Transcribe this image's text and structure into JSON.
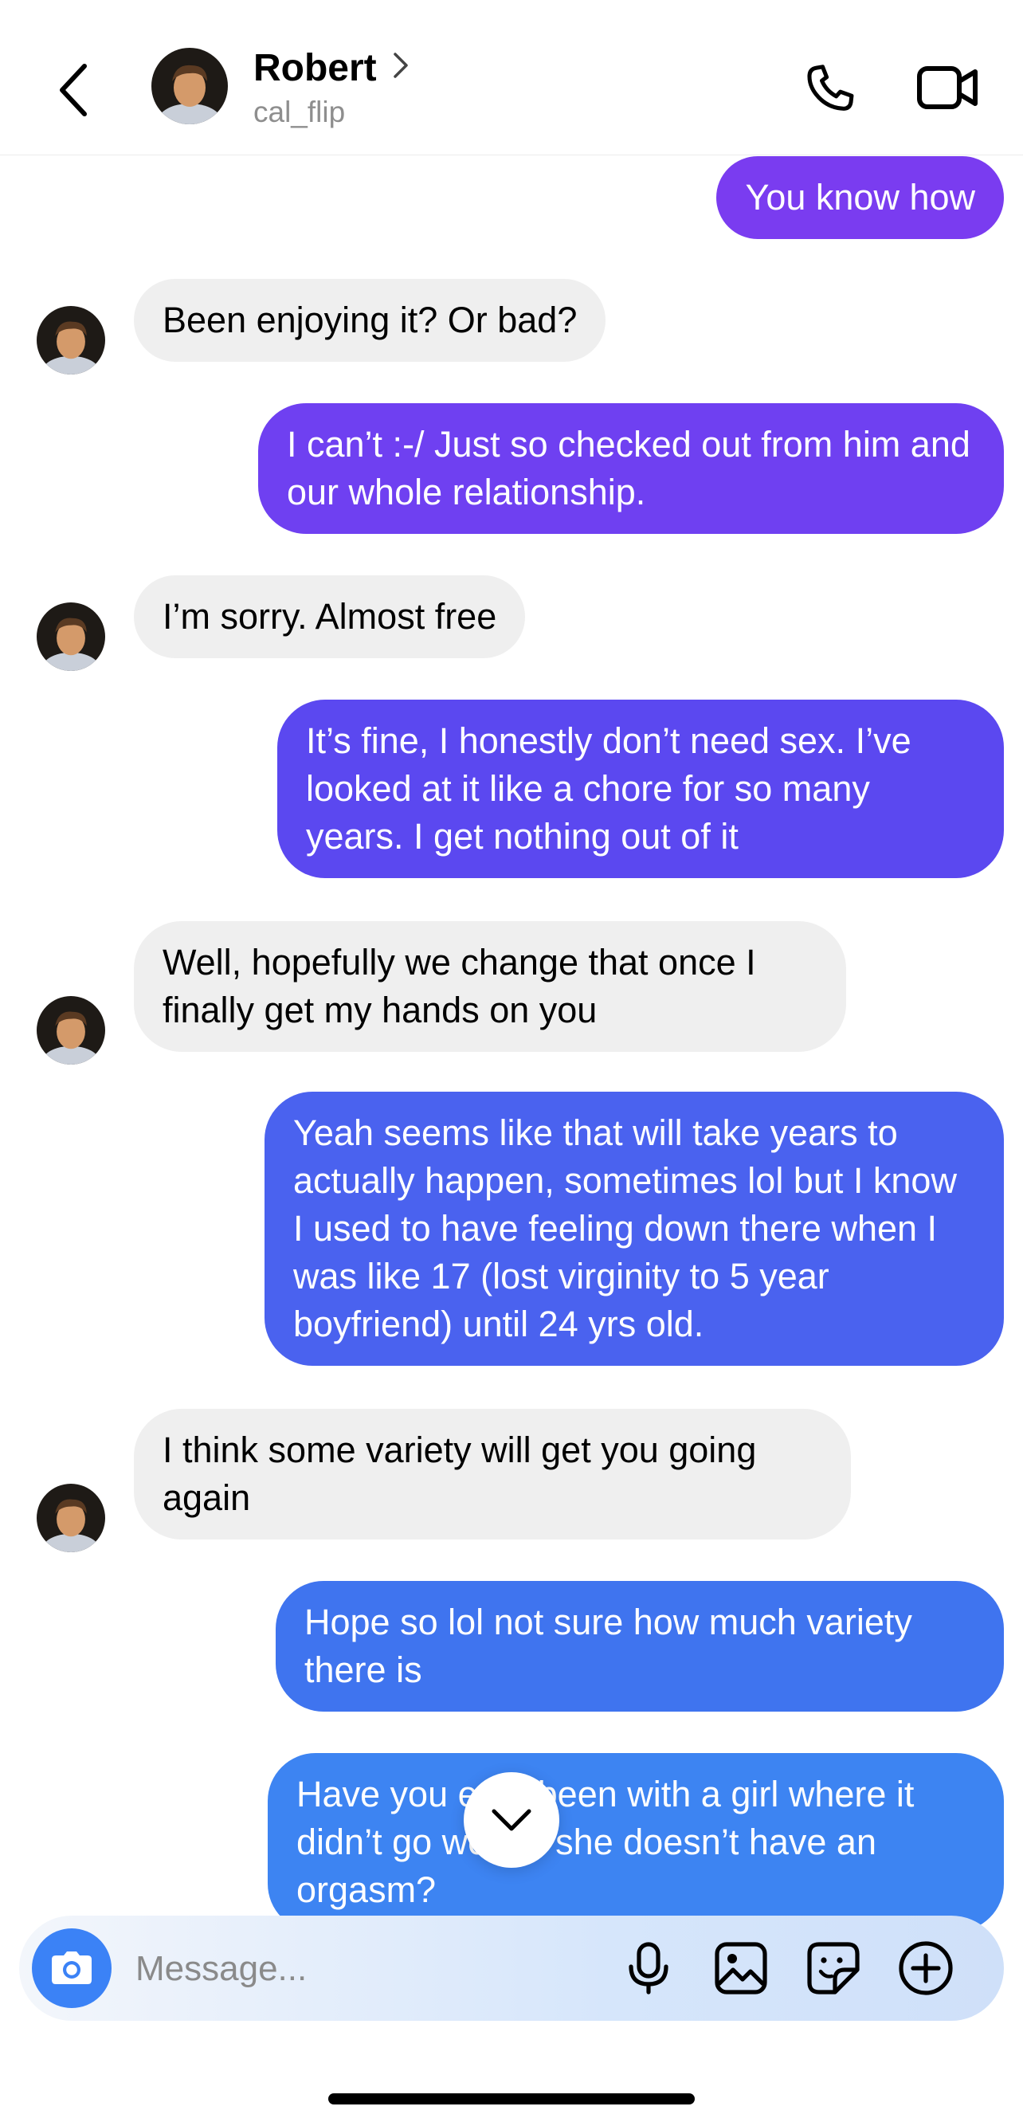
{
  "header": {
    "name": "Robert",
    "username": "cal_flip"
  },
  "messages": [
    {
      "side": "out",
      "text": "You know how"
    },
    {
      "side": "in",
      "text": "Been enjoying it? Or bad?"
    },
    {
      "side": "out",
      "text": "I can’t :-/ Just so checked out from him and our whole relationship."
    },
    {
      "side": "in",
      "text": "I’m sorry. Almost free"
    },
    {
      "side": "out",
      "text": "It’s fine, I honestly don’t need sex. I’ve looked at it like a chore for so many years. I get nothing out of it"
    },
    {
      "side": "in",
      "text": "Well, hopefully we change that once I finally get my hands on you"
    },
    {
      "side": "out",
      "text": "Yeah seems like that will take years to actually happen, sometimes lol but I know I used to have feeling down there when I was like 17 (lost virginity to 5 year boyfriend) until 24 yrs old."
    },
    {
      "side": "in",
      "text": "I think some variety will get you going again"
    },
    {
      "side": "out",
      "text": "Hope so lol not sure how much variety there is"
    },
    {
      "side": "out",
      "text": "Have you ever been with a girl where it didn’t go well or she doesn’t have an orgasm?"
    }
  ],
  "composer": {
    "placeholder": "Message..."
  },
  "icons": {
    "back": "chevron-left-icon",
    "call": "phone-icon",
    "video": "video-camera-icon",
    "camera": "camera-icon",
    "mic": "microphone-icon",
    "gallery": "image-icon",
    "sticker": "sticker-icon",
    "more": "plus-circle-icon",
    "scroll": "chevron-down-icon"
  },
  "colors": {
    "incoming_bubble": "#efefef",
    "outgoing_top": "#7a3cf0",
    "outgoing_bottom": "#3d84f2",
    "accent": "#3b82f6"
  }
}
